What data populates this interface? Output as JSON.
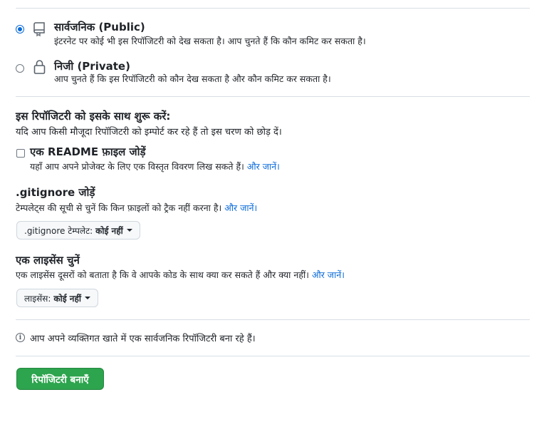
{
  "visibility": {
    "public": {
      "title": "सार्वजनिक (Public)",
      "description": "इंटरनेट पर कोई भी इस रिपॉजिटरी को देख सकता है। आप चुनते हैं कि कौन कमिट कर सकता है।",
      "selected": true
    },
    "private": {
      "title": "निजी (Private)",
      "description": "आप चुनते हैं कि इस रिपॉजिटरी को कौन देख सकता है और कौन कमिट कर सकता है।",
      "selected": false
    }
  },
  "init": {
    "title": "इस रिपॉजिटरी को इसके साथ शुरू करें:",
    "description": "यदि आप किसी मौजूदा रिपॉजिटरी को इम्पोर्ट कर रहे हैं तो इस चरण को छोड़ दें।",
    "readme": {
      "label": "एक README फ़ाइल जोड़ें",
      "description": "यहाँ आप अपने प्रोजेक्ट के लिए एक विस्तृत विवरण लिख सकते हैं।",
      "learn_more": "और जानें।",
      "checked": false
    }
  },
  "gitignore": {
    "title": ".gitignore जोड़ें",
    "description": "टेम्पलेट्स की सूची से चुनें कि किन फ़ाइलों को ट्रैक नहीं करना है।",
    "learn_more": "और जानें।",
    "select_label": ".gitignore टेम्पलेट:",
    "select_value": "कोई नहीं"
  },
  "license": {
    "title": "एक लाइसेंस चुनें",
    "description": "एक लाइसेंस दूसरों को बताता है कि वे आपके कोड के साथ क्या कर सकते हैं और क्या नहीं।",
    "learn_more": "और जानें।",
    "select_label": "लाइसेंस:",
    "select_value": "कोई नहीं"
  },
  "notice": {
    "icon": "info-icon",
    "text": "आप अपने व्यक्तिगत खाते में एक सार्वजनिक रिपॉजिटरी बना रहे हैं।"
  },
  "submit": {
    "label": "रिपॉजिटरी बनाएँ",
    "color": "#2da44e"
  }
}
